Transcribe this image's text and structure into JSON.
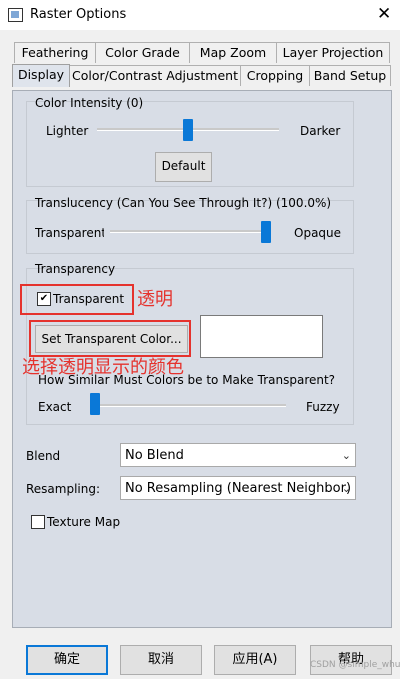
{
  "window": {
    "title": "Raster Options",
    "close_glyph": "✕"
  },
  "tabs_row1": [
    "Feathering",
    "Color Grade",
    "Map Zoom",
    "Layer Projection"
  ],
  "tabs_row2": [
    "Display",
    "Color/Contrast Adjustment",
    "Cropping",
    "Band Setup"
  ],
  "color_intensity": {
    "label": "Color Intensity (0)",
    "left": "Lighter",
    "right": "Darker",
    "slider_value": 0.5,
    "default_button": "Default"
  },
  "translucency": {
    "label": "Translucency (Can You See Through It?) (100.0%)",
    "left": "Transparent",
    "right": "Opaque",
    "slider_value": 1.0
  },
  "transparency": {
    "label": "Transparency",
    "checkbox_label": "Transparent",
    "checked": true,
    "set_color_button": "Set Transparent Color...",
    "swatch_color": "#ffffff",
    "similarity_label": "How Similar Must Colors be to Make Transparent?",
    "left": "Exact",
    "right": "Fuzzy",
    "slider_value": 0.0
  },
  "blend": {
    "label": "Blend",
    "value": "No Blend"
  },
  "resampling": {
    "label": "Resampling:",
    "value": "No Resampling (Nearest Neighbor)"
  },
  "texture_map": {
    "label": "Texture Map",
    "checked": false
  },
  "annotations": {
    "transparent_note": "透明",
    "set_color_note": "选择透明显示的颜色",
    "color": "#e5322d"
  },
  "buttons": {
    "ok": "确定",
    "cancel": "取消",
    "apply": "应用(A)",
    "help": "帮助"
  },
  "watermark": "CSDN @simple_whu"
}
